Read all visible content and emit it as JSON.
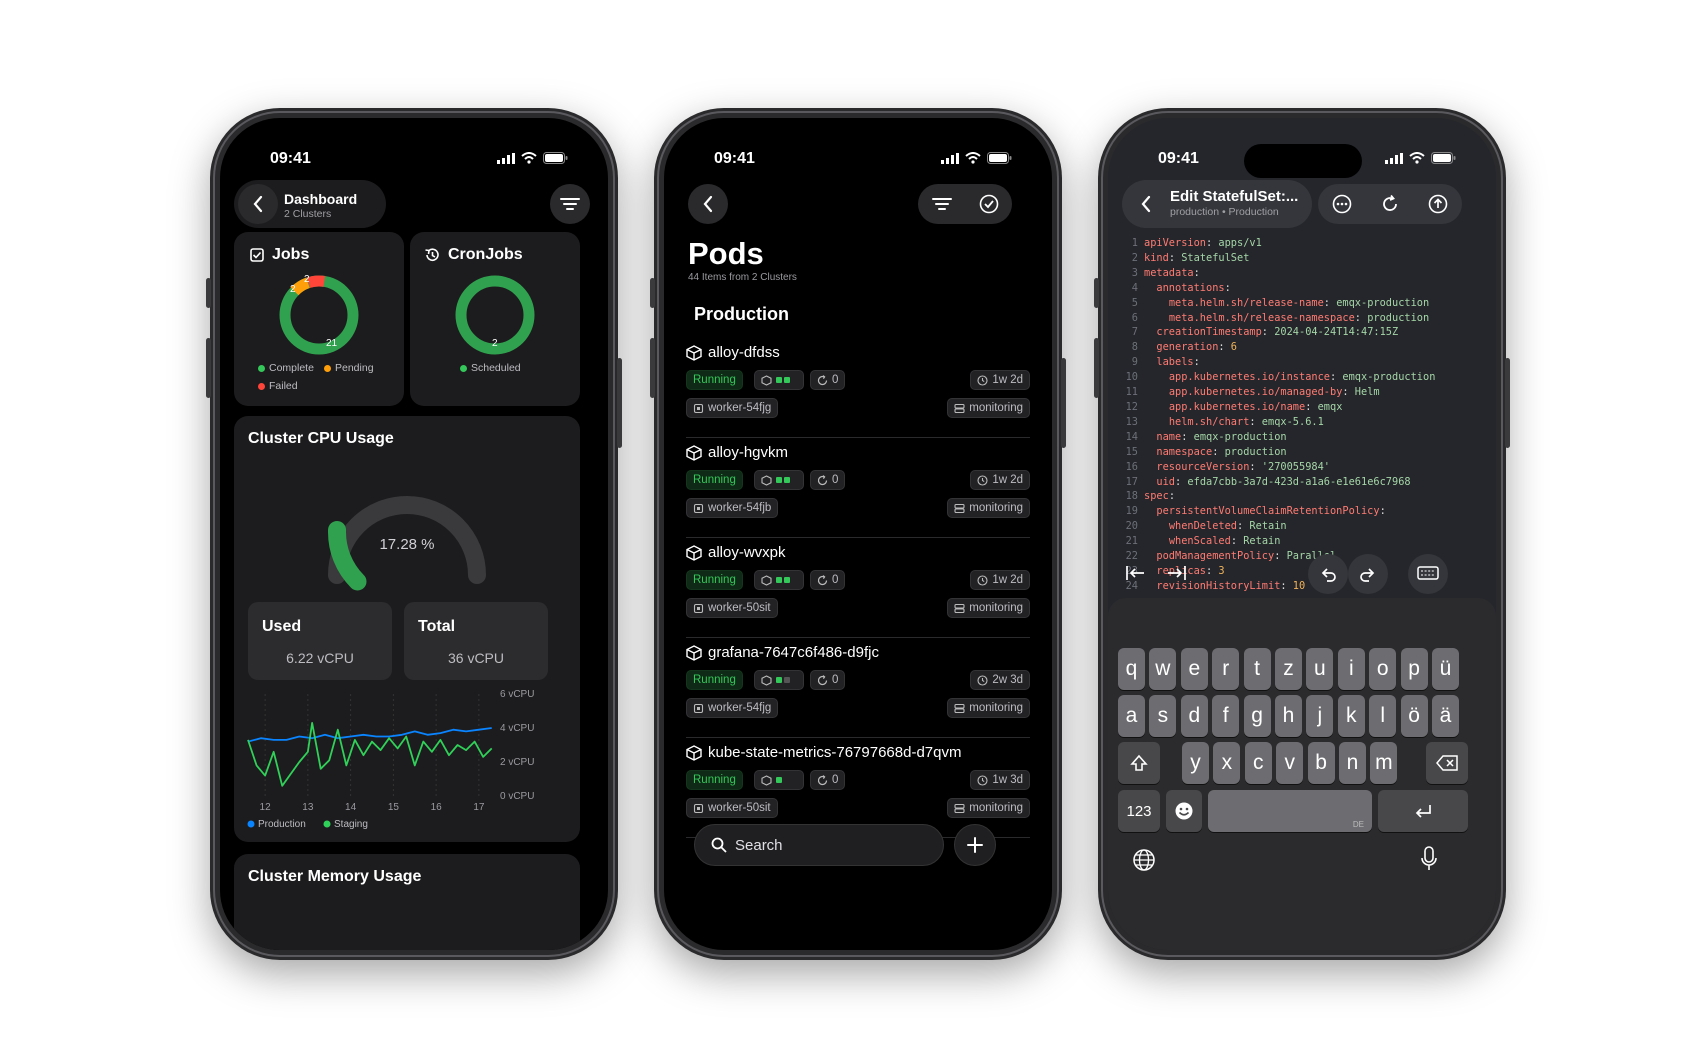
{
  "colors": {
    "accent_green": "#34c759",
    "orange": "#ff9f0a",
    "red": "#ff453a",
    "blue": "#0a84ff"
  },
  "status": {
    "time": "09:41"
  },
  "dashboard": {
    "title": "Dashboard",
    "subtitle": "2 Clusters",
    "jobs": {
      "title": "Jobs",
      "counts": {
        "complete": 21,
        "pending": 2,
        "failed": 2
      },
      "labels": {
        "complete": "21",
        "pending": "2",
        "failed": "2"
      },
      "legend": {
        "complete": "Complete",
        "pending": "Pending",
        "failed": "Failed"
      }
    },
    "cronjobs": {
      "title": "CronJobs",
      "label": "2",
      "legend": "Scheduled"
    },
    "cpu": {
      "title": "Cluster CPU Usage",
      "percent": 17.28,
      "percent_label": "17.28 %",
      "used_title": "Used",
      "used_value": "6.22 vCPU",
      "total_title": "Total",
      "total_value": "36 vCPU"
    },
    "memory_title": "Cluster Memory Usage"
  },
  "chart_data": {
    "type": "line",
    "x_ticks": [
      "12",
      "13",
      "14",
      "15",
      "16",
      "17"
    ],
    "y_ticks": [
      "6 vCPU",
      "4 vCPU",
      "2 vCPU",
      "0 vCPU"
    ],
    "ylim": [
      0,
      6
    ],
    "xlim": [
      11.6,
      17.4
    ],
    "legend_position": "bottom-left",
    "series": [
      {
        "name": "Production",
        "color": "#0a84ff",
        "x": [
          11.6,
          11.9,
          12.2,
          12.5,
          12.8,
          13.1,
          13.4,
          13.7,
          14.0,
          14.3,
          14.6,
          14.9,
          15.2,
          15.5,
          15.8,
          16.1,
          16.4,
          16.7,
          17.0,
          17.3
        ],
        "values": [
          3.2,
          3.4,
          3.3,
          3.3,
          3.5,
          3.4,
          3.6,
          3.4,
          3.5,
          3.6,
          3.5,
          3.5,
          3.6,
          3.8,
          3.6,
          3.7,
          3.9,
          3.8,
          3.9,
          4.0
        ]
      },
      {
        "name": "Staging",
        "color": "#30d158",
        "x": [
          11.6,
          11.8,
          12.0,
          12.2,
          12.4,
          12.6,
          12.8,
          13.0,
          13.1,
          13.3,
          13.5,
          13.7,
          13.9,
          14.1,
          14.3,
          14.5,
          14.7,
          14.9,
          15.1,
          15.3,
          15.5,
          15.7,
          15.9,
          16.1,
          16.3,
          16.5,
          16.7,
          16.9,
          17.1,
          17.3
        ],
        "values": [
          3.3,
          1.8,
          1.2,
          2.6,
          0.6,
          1.3,
          2.0,
          2.6,
          4.3,
          1.6,
          2.1,
          3.9,
          1.8,
          3.3,
          2.4,
          3.2,
          2.7,
          3.4,
          2.8,
          3.5,
          1.8,
          3.2,
          2.6,
          3.3,
          2.4,
          3.0,
          2.7,
          3.2,
          2.3,
          2.8
        ]
      }
    ]
  },
  "pods": {
    "title": "Pods",
    "subtitle": "44 Items from 2 Clusters",
    "section": "Production",
    "items": [
      {
        "name": "alloy-dfdss",
        "status": "Running",
        "restarts": "0",
        "age": "1w 2d",
        "node": "worker-54fjg",
        "namespace": "monitoring",
        "containers": [
          1,
          1
        ]
      },
      {
        "name": "alloy-hgvkm",
        "status": "Running",
        "restarts": "0",
        "age": "1w 2d",
        "node": "worker-54fjb",
        "namespace": "monitoring",
        "containers": [
          1,
          1
        ]
      },
      {
        "name": "alloy-wvxpk",
        "status": "Running",
        "restarts": "0",
        "age": "1w 2d",
        "node": "worker-50sit",
        "namespace": "monitoring",
        "containers": [
          1,
          1
        ]
      },
      {
        "name": "grafana-7647c6f486-d9fjc",
        "status": "Running",
        "restarts": "0",
        "age": "2w 3d",
        "node": "worker-54fjg",
        "namespace": "monitoring",
        "containers": [
          1,
          0
        ]
      },
      {
        "name": "kube-state-metrics-76797668d-d7qvm",
        "status": "Running",
        "restarts": "0",
        "age": "1w 3d",
        "node": "worker-50sit",
        "namespace": "monitoring",
        "containers": [
          1
        ]
      }
    ],
    "search_placeholder": "Search"
  },
  "editor": {
    "title": "Edit StatefulSet:...",
    "subtitle": "production • Production",
    "lines": [
      "apiVersion: apps/v1",
      "kind: StatefulSet",
      "metadata:",
      "  annotations:",
      "    meta.helm.sh/release-name: emqx-production",
      "    meta.helm.sh/release-namespace: production",
      "  creationTimestamp: 2024-04-24T14:47:15Z",
      "  generation: 6",
      "  labels:",
      "    app.kubernetes.io/instance: emqx-production",
      "    app.kubernetes.io/managed-by: Helm",
      "    app.kubernetes.io/name: emqx",
      "    helm.sh/chart: emqx-5.6.1",
      "  name: emqx-production",
      "  namespace: production",
      "  resourceVersion: '270055984'",
      "  uid: efda7cbb-3a7d-423d-a1a6-e1e61e6c7968",
      "spec:",
      "  persistentVolumeClaimRetentionPolicy:",
      "    whenDeleted: Retain",
      "    whenScaled: Retain",
      "  podManagementPolicy: Parallel",
      "  replicas: 3",
      "  revisionHistoryLimit: 10"
    ],
    "keyboard": {
      "row1": [
        "q",
        "w",
        "e",
        "r",
        "t",
        "z",
        "u",
        "i",
        "o",
        "p",
        "ü"
      ],
      "row2": [
        "a",
        "s",
        "d",
        "f",
        "g",
        "h",
        "j",
        "k",
        "l",
        "ö",
        "ä"
      ],
      "row3": [
        "y",
        "x",
        "c",
        "v",
        "b",
        "n",
        "m"
      ],
      "numbers_key": "123",
      "space_label": "DE"
    }
  }
}
